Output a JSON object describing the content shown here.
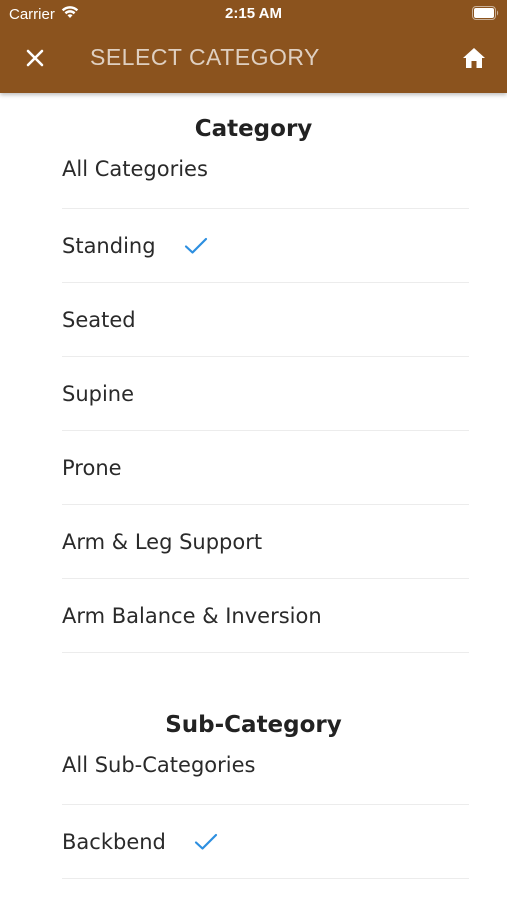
{
  "status_bar": {
    "carrier": "Carrier",
    "time": "2:15 AM"
  },
  "nav": {
    "title": "SELECT CATEGORY",
    "close_icon": "close-icon",
    "home_icon": "home-icon"
  },
  "colors": {
    "header_bg": "#8b531e",
    "check": "#2d8fe0"
  },
  "category": {
    "title": "Category",
    "items": [
      {
        "label": "All Categories",
        "selected": false
      },
      {
        "label": "Standing",
        "selected": true
      },
      {
        "label": "Seated",
        "selected": false
      },
      {
        "label": "Supine",
        "selected": false
      },
      {
        "label": "Prone",
        "selected": false
      },
      {
        "label": "Arm & Leg Support",
        "selected": false
      },
      {
        "label": "Arm Balance & Inversion",
        "selected": false
      }
    ]
  },
  "subcategory": {
    "title": "Sub-Category",
    "items": [
      {
        "label": "All Sub-Categories",
        "selected": false
      },
      {
        "label": "Backbend",
        "selected": true
      }
    ]
  }
}
